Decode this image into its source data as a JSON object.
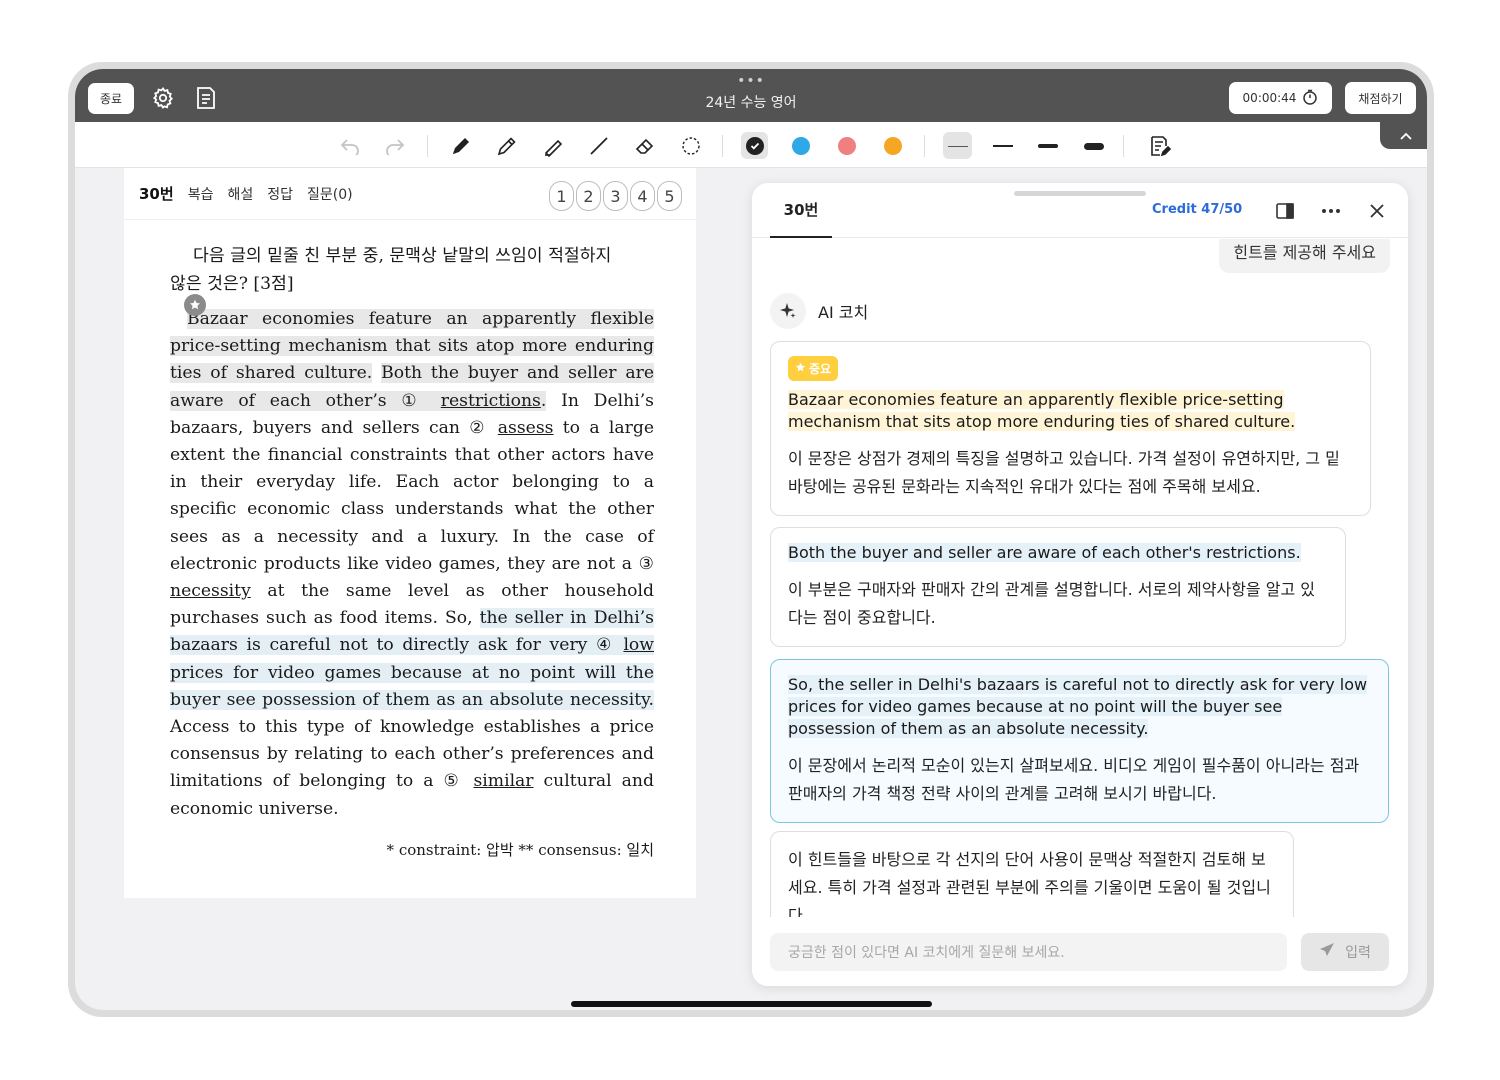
{
  "topbar": {
    "end_label": "종료",
    "title": "24년 수능 영어",
    "timer": "00:00:44",
    "grade_label": "채점하기"
  },
  "question_panel": {
    "number": "30번",
    "tabs": [
      "복습",
      "해설",
      "정답",
      "질문(0)"
    ],
    "choice_numbers": [
      "1",
      "2",
      "3",
      "4",
      "5"
    ],
    "instruction_line1": "다음 글의 밑줄 친 부분 중, 문맥상 낱말의 쓰임이 적절하지",
    "instruction_line2": "않은 것은? [3점]",
    "passage": {
      "p1": "Bazaar economies feature an apparently flexible price-setting mechanism that sits atop more enduring ties of shared culture.",
      "p2a": "Both the buyer and seller are aware of each other’s ",
      "c1": "①",
      "w1": "restrictions",
      "p3a": " In Delhi’s bazaars, buyers and sellers can ",
      "c2": "②",
      "w2": "assess",
      "p3b": " to a large extent the financial constraints that other actors have in their everyday life. Each actor belonging to a specific economic class understands what the other sees as a necessity and a luxury. In the case of electronic products like video games, they are not a ",
      "c3": "③",
      "w3": "necessity",
      "p3c": " at the same level as other household purchases such as food items. So, ",
      "p4a": "the seller in Delhi’s bazaars is careful not to directly ask for very ",
      "c4": "④",
      "w4": "low",
      "p4b": " prices for video games because at no point will the buyer see possession of them as an absolute necessity.",
      "p5a": " Access to this type of knowledge establishes a price consensus by relating to each other’s preferences and limitations of belonging to a ",
      "c5": "⑤",
      "w5": "similar",
      "p5b": " cultural and economic universe."
    },
    "footnote": "* constraint: 압박   ** consensus: 일치"
  },
  "ai_panel": {
    "tab": "30번",
    "credit": "Credit 47/50",
    "user_message": "힌트를 제공해 주세요",
    "coach_name": "AI 코치",
    "cards": [
      {
        "badge": "중요",
        "quote": "Bazaar economies feature an apparently flexible price-setting mechanism that sits atop more enduring ties of shared culture.",
        "explanation": "이 문장은 상점가 경제의 특징을 설명하고 있습니다. 가격 설정이 유연하지만, 그 밑바탕에는 공유된 문화라는 지속적인 유대가 있다는 점에 주목해 보세요."
      },
      {
        "quote": "Both the buyer and seller are aware of each other's restrictions.",
        "explanation": "이 부분은 구매자와 판매자 간의 관계를 설명합니다. 서로의 제약사항을 알고 있다는 점이 중요합니다."
      },
      {
        "quote": "So, the seller in Delhi's bazaars is careful not to directly ask for very low prices for video games because at no point will the buyer see possession of them as an absolute necessity.",
        "explanation": "이 문장에서 논리적 모순이 있는지 살펴보세요. 비디오 게임이 필수품이 아니라는 점과 판매자의 가격 책정 전략 사이의 관계를 고려해 보시기 바랍니다."
      },
      {
        "explanation": "이 힌트들을 바탕으로 각 선지의 단어 사용이 문맥상 적절한지 검토해 보세요. 특히 가격 설정과 관련된 부분에 주의를 기울이면 도움이 될 것입니다."
      }
    ],
    "input_placeholder": "궁금한 점이 있다면 AI 코치에게 질문해 보세요.",
    "send_label": "입력"
  },
  "colors": {
    "topbar": "#535353",
    "pen_black": "#222222",
    "pen_blue": "#2ea8e6",
    "pen_red": "#f07f7f",
    "pen_orange": "#f5a623",
    "credit_blue": "#2d6bd8",
    "badge_yellow": "#ffcf3f"
  },
  "icons": [
    "gear-icon",
    "note-list-icon",
    "stopwatch-icon",
    "chevron-up-icon",
    "undo-icon",
    "redo-icon",
    "pen-icon",
    "pencil-icon",
    "highlighter-icon",
    "line-icon",
    "eraser-icon",
    "lasso-icon",
    "note-edit-icon",
    "split-view-icon",
    "more-icon",
    "close-icon",
    "sparkle-icon",
    "send-icon",
    "star-icon"
  ]
}
